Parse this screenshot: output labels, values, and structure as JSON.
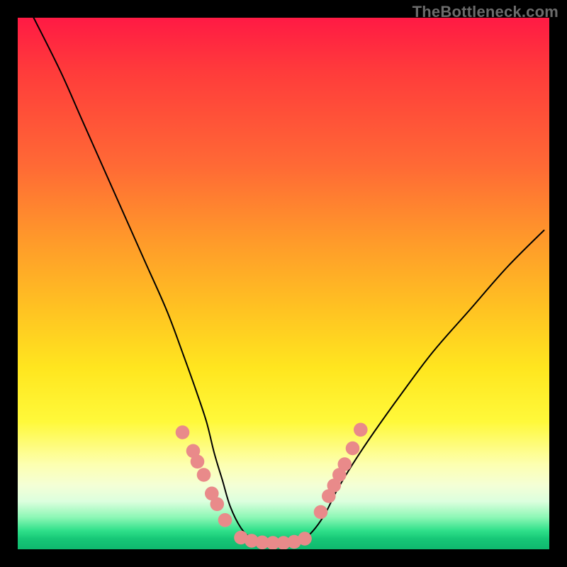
{
  "watermark": "TheBottleneck.com",
  "chart_data": {
    "type": "line",
    "title": "",
    "xlabel": "",
    "ylabel": "",
    "xlim": [
      0,
      100
    ],
    "ylim": [
      0,
      100
    ],
    "grid": false,
    "legend": false,
    "series": [
      {
        "name": "curve",
        "x": [
          3,
          8,
          12,
          16,
          20,
          24,
          28,
          31,
          33.5,
          35.5,
          37,
          38.5,
          40,
          42,
          44,
          46,
          48,
          50,
          52,
          54,
          56,
          58,
          60,
          63,
          67,
          72,
          78,
          85,
          92,
          99
        ],
        "y": [
          100,
          90,
          81,
          72,
          63,
          54,
          45,
          37,
          30,
          24,
          18,
          13,
          8,
          4,
          2,
          1,
          0.6,
          0.6,
          1,
          2,
          4,
          7,
          11,
          16,
          22,
          29,
          37,
          45,
          53,
          60
        ]
      }
    ],
    "markers": {
      "color": "#e98a8a",
      "radius_pct": 1.3,
      "points": [
        {
          "x": 31.0,
          "y": 22.0
        },
        {
          "x": 33.0,
          "y": 18.5
        },
        {
          "x": 33.8,
          "y": 16.5
        },
        {
          "x": 35.0,
          "y": 14.0
        },
        {
          "x": 36.5,
          "y": 10.5
        },
        {
          "x": 37.5,
          "y": 8.5
        },
        {
          "x": 39.0,
          "y": 5.5
        },
        {
          "x": 42.0,
          "y": 2.2
        },
        {
          "x": 44.0,
          "y": 1.6
        },
        {
          "x": 46.0,
          "y": 1.3
        },
        {
          "x": 48.0,
          "y": 1.2
        },
        {
          "x": 50.0,
          "y": 1.2
        },
        {
          "x": 52.0,
          "y": 1.4
        },
        {
          "x": 54.0,
          "y": 2.0
        },
        {
          "x": 57.0,
          "y": 7.0
        },
        {
          "x": 58.5,
          "y": 10.0
        },
        {
          "x": 59.5,
          "y": 12.0
        },
        {
          "x": 60.5,
          "y": 14.0
        },
        {
          "x": 61.5,
          "y": 16.0
        },
        {
          "x": 63.0,
          "y": 19.0
        },
        {
          "x": 64.5,
          "y": 22.5
        }
      ]
    }
  }
}
